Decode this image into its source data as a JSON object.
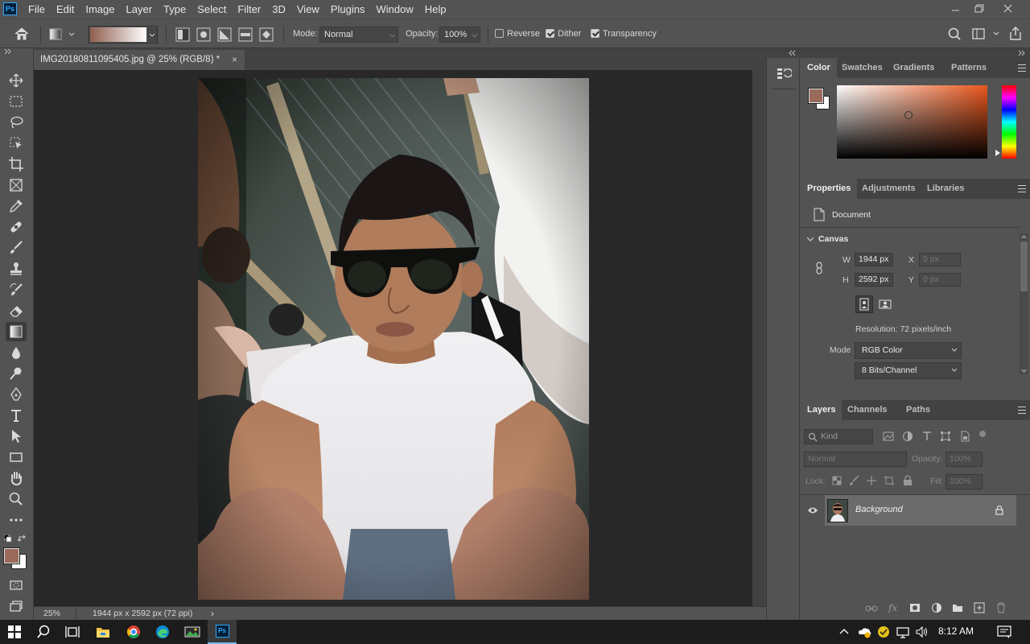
{
  "app": {
    "logo_text": "Ps"
  },
  "menu": [
    "File",
    "Edit",
    "Image",
    "Layer",
    "Type",
    "Select",
    "Filter",
    "3D",
    "View",
    "Plugins",
    "Window",
    "Help"
  ],
  "options": {
    "mode_label": "Mode:",
    "mode_value": "Normal",
    "opacity_label": "Opacity:",
    "opacity_value": "100%",
    "reverse_label": "Reverse",
    "reverse_checked": false,
    "dither_label": "Dither",
    "dither_checked": true,
    "transparency_label": "Transparency",
    "transparency_checked": true,
    "gradient_start_color": "#8f5e4f",
    "gradient_end_color": "#ffffff"
  },
  "document": {
    "tab_title": "IMG20180811095405.jpg @ 25% (RGB/8) *",
    "close_symbol": "×"
  },
  "status": {
    "zoom": "25%",
    "info": "1944 px x 2592 px (72 ppi)",
    "arrow": "›"
  },
  "colors": {
    "foreground": "#9a6a5a",
    "background": "#ffffff",
    "accent": "#31a8ff"
  },
  "color_panel": {
    "tabs": [
      "Color",
      "Swatches",
      "Gradients",
      "Patterns"
    ],
    "active_tab": "Color",
    "hue_color": "#e8561c"
  },
  "properties_panel": {
    "tabs": [
      "Properties",
      "Adjustments",
      "Libraries"
    ],
    "document_label": "Document",
    "canvas_label": "Canvas",
    "w_label": "W",
    "w_value": "1944 px",
    "h_label": "H",
    "h_value": "2592 px",
    "x_label": "X",
    "x_placeholder": "0 px",
    "y_label": "Y",
    "y_placeholder": "0 px",
    "resolution": "Resolution: 72 pixels/inch",
    "mode_label": "Mode",
    "mode_value": "RGB Color",
    "bits_value": "8 Bits/Channel"
  },
  "layers_panel": {
    "tabs": [
      "Layers",
      "Channels",
      "Paths"
    ],
    "kind_placeholder": "Kind",
    "blend_mode": "Normal",
    "opacity_label": "Opacity:",
    "opacity_value": "100%",
    "lock_label": "Lock:",
    "fill_label": "Fill:",
    "fill_value": "100%",
    "layers": [
      {
        "name": "Background",
        "visible": true,
        "locked": true
      }
    ]
  },
  "taskbar": {
    "time": "8:12 AM"
  }
}
